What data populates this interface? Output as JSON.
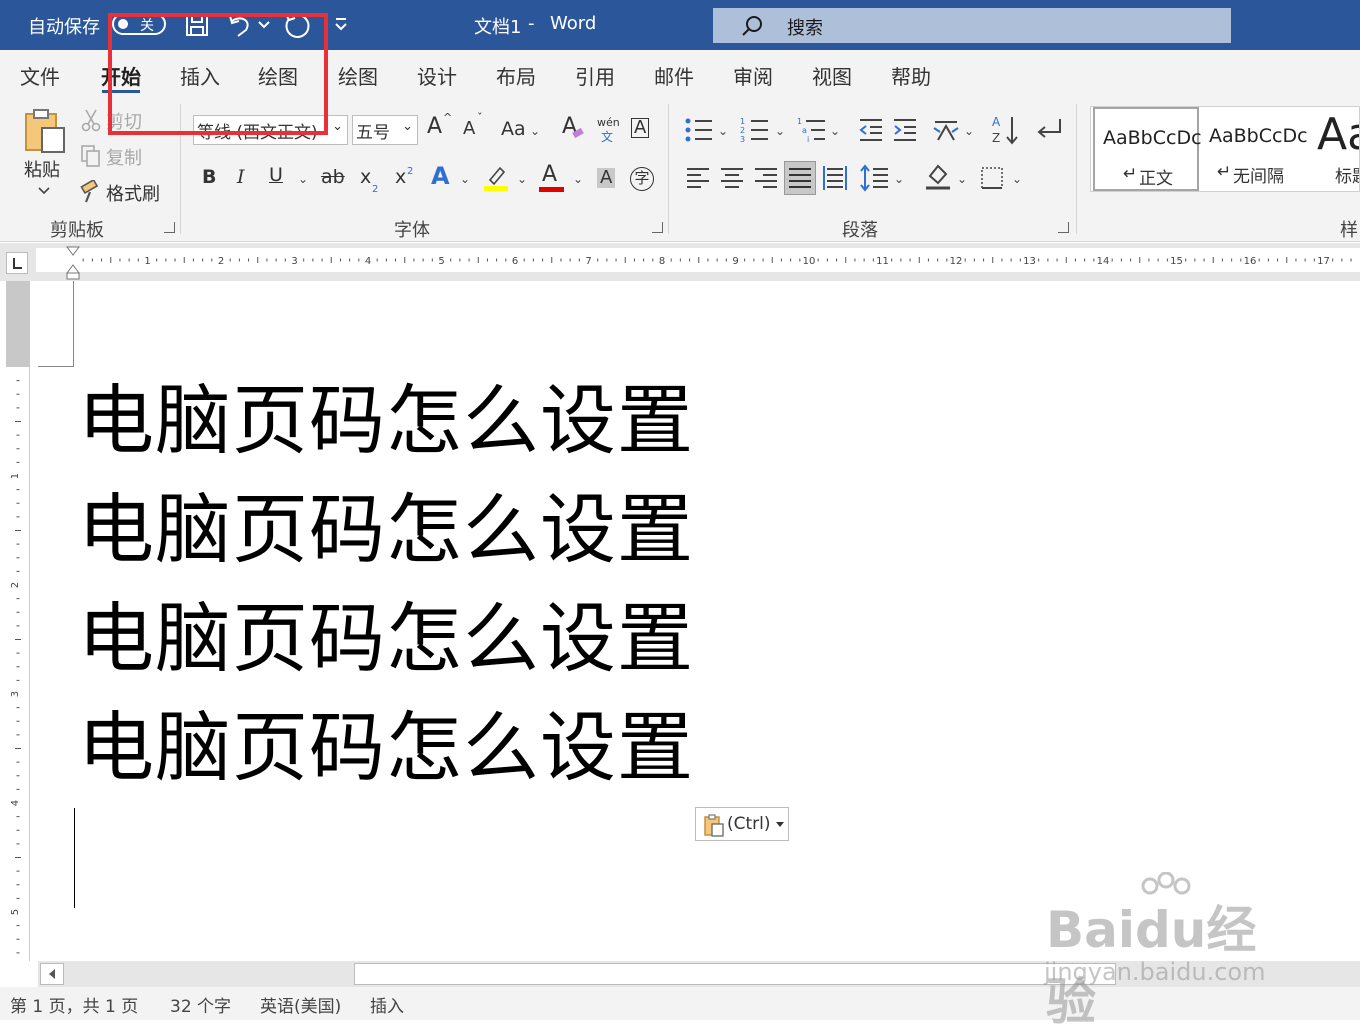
{
  "titlebar": {
    "autosave_label": "自动保存",
    "autosave_state": "关",
    "document_title": "文档1",
    "separator": "-",
    "app_name": "Word",
    "search_placeholder": "搜索",
    "colors": {
      "bar": "#2b579a",
      "search": "#aebfd9"
    }
  },
  "tabs": [
    {
      "label": "文件",
      "active": false
    },
    {
      "label": "开始",
      "active": true
    },
    {
      "label": "插入",
      "active": false
    },
    {
      "label": "绘图",
      "active": false
    },
    {
      "label": "绘图",
      "active": false
    },
    {
      "label": "设计",
      "active": false
    },
    {
      "label": "布局",
      "active": false
    },
    {
      "label": "引用",
      "active": false
    },
    {
      "label": "邮件",
      "active": false
    },
    {
      "label": "审阅",
      "active": false
    },
    {
      "label": "视图",
      "active": false
    },
    {
      "label": "帮助",
      "active": false
    }
  ],
  "clipboard": {
    "group_label": "剪贴板",
    "paste_label": "粘贴",
    "cut_label": "剪切",
    "copy_label": "复制",
    "format_painter_label": "格式刷"
  },
  "font": {
    "group_label": "字体",
    "font_name": "等线 (西文正文)",
    "font_size": "五号",
    "grow_label": "A",
    "shrink_label": "A",
    "change_case_label": "Aa",
    "phonetic_top": "wén",
    "phonetic_bottom": "文",
    "border_char_label": "A",
    "bold": "B",
    "italic": "I",
    "underline": "U",
    "strikethrough": "ab",
    "subscript": "x",
    "subscript_mark": "2",
    "superscript": "x",
    "superscript_mark": "2",
    "text_effects": "A",
    "font_color": "A",
    "char_shading": "A",
    "enclose": "字",
    "colors": {
      "highlight": "#ffff00",
      "font_color": "#e00000",
      "effects": "#2f6fd0"
    }
  },
  "paragraph": {
    "group_label": "段落"
  },
  "styles": {
    "group_label": "样",
    "items": [
      {
        "preview": "AaBbCcDc",
        "name": "正文"
      },
      {
        "preview": "AaBbCcDc",
        "name": "无间隔"
      },
      {
        "preview": "Aa",
        "name": "标题"
      }
    ]
  },
  "ruler": {
    "numbers": [
      "1",
      "2",
      "3",
      "4",
      "5",
      "6",
      "7",
      "8",
      "9",
      "10",
      "11",
      "12",
      "13",
      "14",
      "15",
      "16",
      "17"
    ],
    "v_numbers": [
      "1",
      "2",
      "3",
      "4",
      "5"
    ]
  },
  "document": {
    "lines": [
      "电脑页码怎么设置",
      "电脑页码怎么设置",
      "电脑页码怎么设置",
      "电脑页码怎么设置"
    ],
    "paste_options_label": "(Ctrl)"
  },
  "statusbar": {
    "page": "第 1 页，共 1 页",
    "words": "32 个字",
    "language": "英语(美国)",
    "mode": "插入"
  },
  "watermark": {
    "brand": "Baidu经验",
    "url": "jingyan.baidu.com"
  },
  "annotation": {
    "highlight_color": "#e8303a"
  }
}
